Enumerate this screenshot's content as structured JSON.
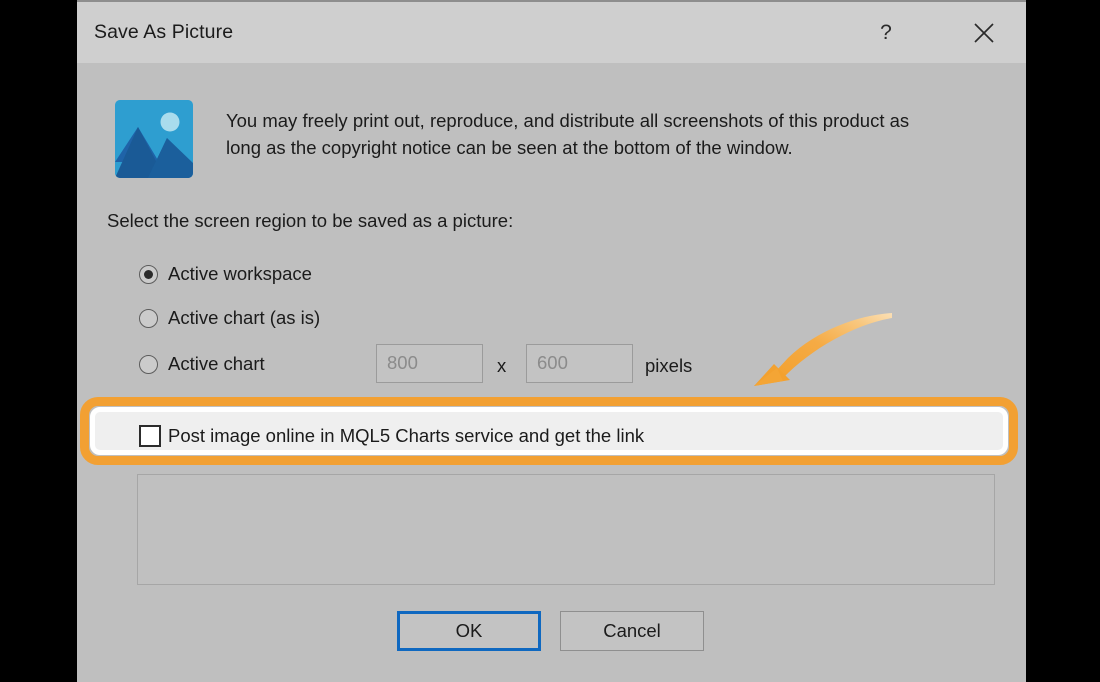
{
  "window": {
    "title": "Save As Picture",
    "help_icon": "question-mark-icon",
    "close_icon": "close-icon"
  },
  "content": {
    "picture_icon": "picture-icon",
    "notice": "You may freely print out, reproduce, and distribute all screenshots of this product as long as the copyright notice can be seen at the bottom of the window.",
    "select_label": "Select the screen region to be saved as a picture:",
    "radio_options": [
      {
        "label": "Active workspace",
        "checked": true
      },
      {
        "label": "Active chart (as is)",
        "checked": false
      },
      {
        "label": "Active chart",
        "checked": false
      }
    ],
    "size": {
      "width_value": "800",
      "separator": "x",
      "height_value": "600",
      "units_label": "pixels"
    },
    "post_online": {
      "label": "Post image online in MQL5 Charts service and get the link",
      "checked": false,
      "highlighted": true
    },
    "link_box_value": ""
  },
  "footer": {
    "ok_label": "OK",
    "cancel_label": "Cancel"
  },
  "annotation": {
    "arrow_icon": "curved-arrow-icon",
    "arrow_color": "#f5a83c"
  },
  "colors": {
    "highlight": "#f2a033",
    "titlebar": "#cfcfcf",
    "dialog_background": "#bfbfbf",
    "default_button_border": "#0f68c0",
    "icon_blue": "#2e9ed0",
    "icon_dark_blue": "#1a5a96"
  }
}
